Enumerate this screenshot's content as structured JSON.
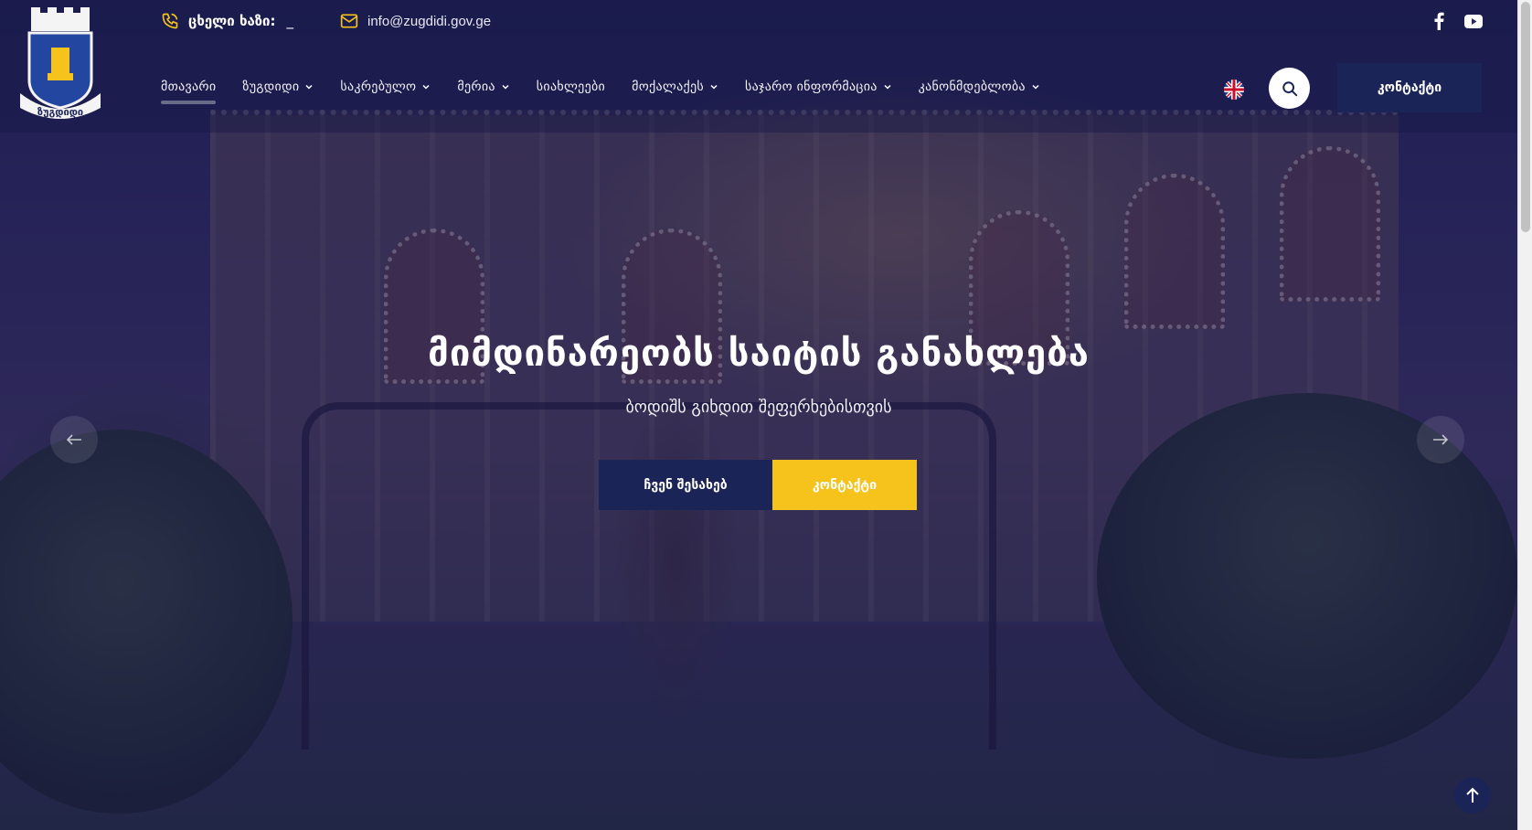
{
  "header": {
    "hotline_label": "ცხელი ხაზი:",
    "hotline_value": "_",
    "email": "info@zugdidi.gov.ge",
    "logo_text": "ზუგდიდი",
    "language": "en",
    "contact_button": "კონტაქტი"
  },
  "nav": {
    "items": [
      {
        "label": "მთავარი",
        "has_dropdown": false,
        "active": true
      },
      {
        "label": "ზუგდიდი",
        "has_dropdown": true
      },
      {
        "label": "საკრებულო",
        "has_dropdown": true
      },
      {
        "label": "მერია",
        "has_dropdown": true
      },
      {
        "label": "სიახლეები",
        "has_dropdown": false
      },
      {
        "label": "მოქალაქეს",
        "has_dropdown": true
      },
      {
        "label": "საჯარო ინფორმაცია",
        "has_dropdown": true
      },
      {
        "label": "კანონმდებლობა",
        "has_dropdown": true
      }
    ]
  },
  "hero": {
    "title": "მიმდინარეობს საიტის განახლება",
    "subtitle": "ბოდიშს გიხდით შეფერხებისთვის",
    "about_button": "ჩვენ შესახებ",
    "contact_button": "კონტაქტი"
  },
  "icons": {
    "phone": "phone-icon",
    "mail": "mail-icon",
    "facebook": "facebook-icon",
    "youtube": "youtube-icon",
    "search": "search-icon",
    "prev": "arrow-left-icon",
    "next": "arrow-right-icon",
    "scroll_top": "arrow-up-icon"
  },
  "colors": {
    "accent_yellow": "#f5c31b",
    "navy": "#1b2457",
    "overlay": "#181652"
  }
}
